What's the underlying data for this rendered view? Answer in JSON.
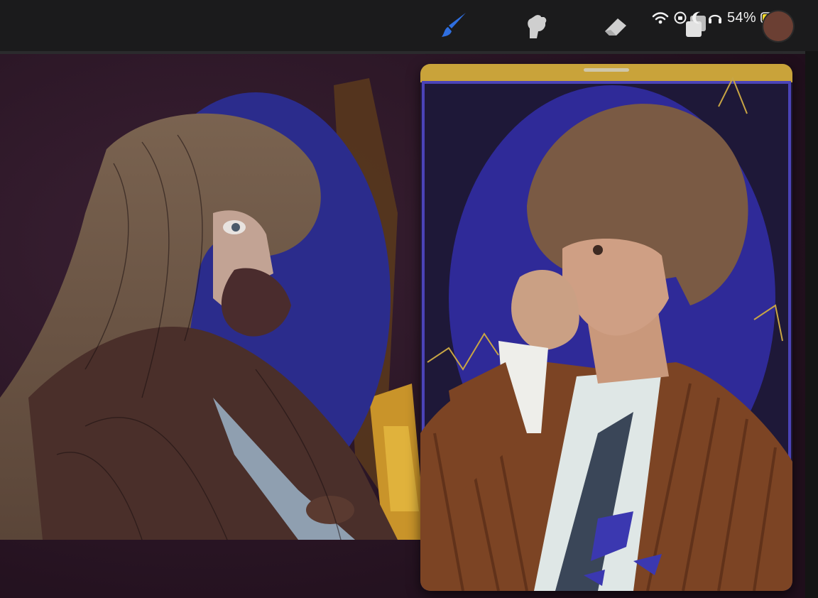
{
  "toolbar": {
    "tools": [
      {
        "name": "brush",
        "icon": "brush-icon",
        "active": true
      },
      {
        "name": "smudge",
        "icon": "smudge-icon",
        "active": false
      },
      {
        "name": "eraser",
        "icon": "eraser-icon",
        "active": false
      },
      {
        "name": "layers",
        "icon": "layers-icon",
        "active": false
      }
    ],
    "active_color": "#2f6fe0",
    "inactive_color": "#cfcfcf"
  },
  "status_bar": {
    "wifi_icon": "wifi-icon",
    "rotation_lock_icon": "rotation-lock-icon",
    "moon_icon": "moon-icon",
    "headphones_icon": "headphones-icon",
    "battery_percent": "54%",
    "battery_charging": true,
    "battery_color": "#f5d92a"
  },
  "current_color": "#6b3f33",
  "reference_window": {
    "frame_color": "#c9a33a",
    "grab_handle_color": "#cfc6a8"
  }
}
